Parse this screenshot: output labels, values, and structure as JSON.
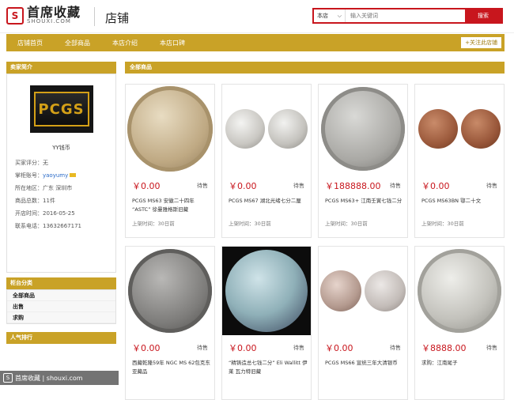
{
  "header": {
    "logo_cn": "首席收藏",
    "logo_en": "SHOUXI.COM",
    "logo_mark": "S",
    "store_label": "店铺",
    "search_scope": "本店",
    "search_placeholder": "输入关键词",
    "search_button": "搜索"
  },
  "nav": {
    "items": [
      "店铺首页",
      "全部商品",
      "本店介绍",
      "本店口碑"
    ],
    "follow": "+关注此店铺"
  },
  "sidebar": {
    "intro_title": "卖家简介",
    "logo_text": "PCGS",
    "shop_name": "YY钱币",
    "rating_label": "买家评分：",
    "rating_value": "无",
    "account_label": "掌柜账号：",
    "account_value": "yaoyumy",
    "location_label": "所在地区：",
    "location_value": "广东 深圳市",
    "total_label": "商品总数：",
    "total_value": "11件",
    "opened_label": "开店时间：",
    "opened_value": "2016-05-25",
    "phone_label": "联系电话：",
    "phone_value": "13632667171",
    "category_title": "柜台分类",
    "categories": [
      "全部商品",
      "出售",
      "求购"
    ],
    "ranking_title": "人气排行"
  },
  "main": {
    "title": "全部商品",
    "products": [
      {
        "price": "￥0.00",
        "status": "待售",
        "title": "PCGS MS63 安徽二十四年 “ASTC” 徐曼雅格斯旧藏",
        "date": "上架时间：30日前"
      },
      {
        "price": "￥0.00",
        "status": "待售",
        "title": "PCGS MS67 湖北光绪七分二厘",
        "date": "上架时间：30日前"
      },
      {
        "price": "￥188888.00",
        "status": "待售",
        "title": "PCGS MS63+ 江南壬寅七钱二分",
        "date": "上架时间：30日前"
      },
      {
        "price": "￥0.00",
        "status": "待售",
        "title": "PCGS MS63BN 鄂二十文",
        "date": "上架时间：30日前"
      },
      {
        "price": "￥0.00",
        "status": "待售",
        "title": "西藏乾隆59年 NGC MS 62包克东亚藏品",
        "date": ""
      },
      {
        "price": "￥0.00",
        "status": "待售",
        "title": "“精铸造总七钱二分” Eli Wallitt 伊莱 瓦力特旧藏",
        "date": ""
      },
      {
        "price": "￥0.00",
        "status": "待售",
        "title": "PCGS MS66 宣统三年大清银币",
        "date": ""
      },
      {
        "price": "￥8888.00",
        "status": "待售",
        "title": "求购：江南尾子",
        "date": ""
      }
    ]
  },
  "watermark": {
    "mark": "S",
    "text": "首席收藏 | shouxi.com"
  }
}
